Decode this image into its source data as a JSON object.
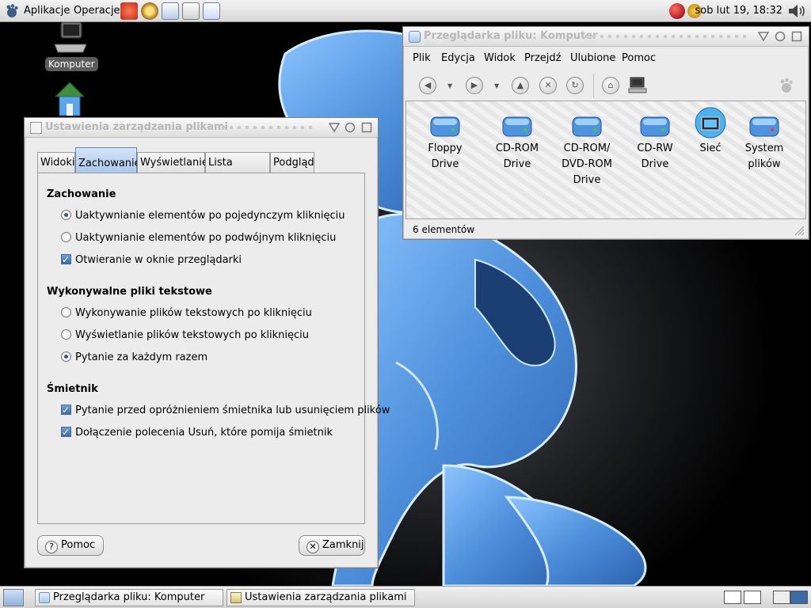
{
  "top_panel": {
    "menu_apps": "Aplikacje",
    "menu_actions": "Operacje",
    "clock": "sob lut 19, 18:32"
  },
  "desktop": {
    "icons": [
      {
        "label": "Komputer"
      }
    ]
  },
  "settings_window": {
    "title": "Ustawienia zarządzania plikami",
    "tabs": [
      "Widoki",
      "Zachowanie",
      "Wyświetlanie",
      "Lista kolumn",
      "Podgląd"
    ],
    "active_tab": "Zachowanie",
    "sections": [
      {
        "heading": "Zachowanie",
        "options": [
          {
            "type": "radio",
            "label": "Uaktywnianie elementów po pojedynczym kliknięciu",
            "checked": true
          },
          {
            "type": "radio",
            "label": "Uaktywnianie elementów po podwójnym kliknięciu",
            "checked": false
          },
          {
            "type": "check",
            "label": "Otwieranie w oknie przeglądarki",
            "checked": true
          }
        ]
      },
      {
        "heading": "Wykonywalne pliki tekstowe",
        "options": [
          {
            "type": "radio",
            "label": "Wykonywanie plików tekstowych po kliknięciu",
            "checked": false
          },
          {
            "type": "radio",
            "label": "Wyświetlanie plików tekstowych po kliknięciu",
            "checked": false
          },
          {
            "type": "radio",
            "label": "Pytanie za każdym razem",
            "checked": true
          }
        ]
      },
      {
        "heading": "Śmietnik",
        "options": [
          {
            "type": "check",
            "label": "Pytanie przed opróżnieniem śmietnika lub usunięciem plików",
            "checked": true
          },
          {
            "type": "check",
            "label": "Dołączenie polecenia Usuń, które pomija śmietnik",
            "checked": true
          }
        ]
      }
    ],
    "help_button": "Pomoc",
    "close_button": "Zamknij"
  },
  "file_browser": {
    "title": "Przeglądarka pliku: Komputer",
    "menu": [
      "Plik",
      "Edycja",
      "Widok",
      "Przejdź",
      "Ulubione",
      "Pomoc"
    ],
    "items": [
      {
        "label": "Floppy Drive",
        "icon": "floppy-drive-icon"
      },
      {
        "label": "CD-ROM Drive",
        "icon": "cdrom-drive-icon"
      },
      {
        "label": "CD-ROM/ DVD-ROM Drive",
        "icon": "dvd-drive-icon"
      },
      {
        "label": "CD-RW Drive",
        "icon": "cdrw-drive-icon"
      },
      {
        "label": "Sieć",
        "icon": "network-icon"
      },
      {
        "label": "System plików",
        "icon": "filesystem-icon"
      }
    ],
    "status": "6 elementów"
  },
  "taskbar": {
    "tasks": [
      "Przeglądarka pliku: Komputer",
      "Ustawienia zarządzania plikami"
    ]
  },
  "colors": {
    "accent": "#5f87bd",
    "lion_blue": "#5a9be6"
  }
}
